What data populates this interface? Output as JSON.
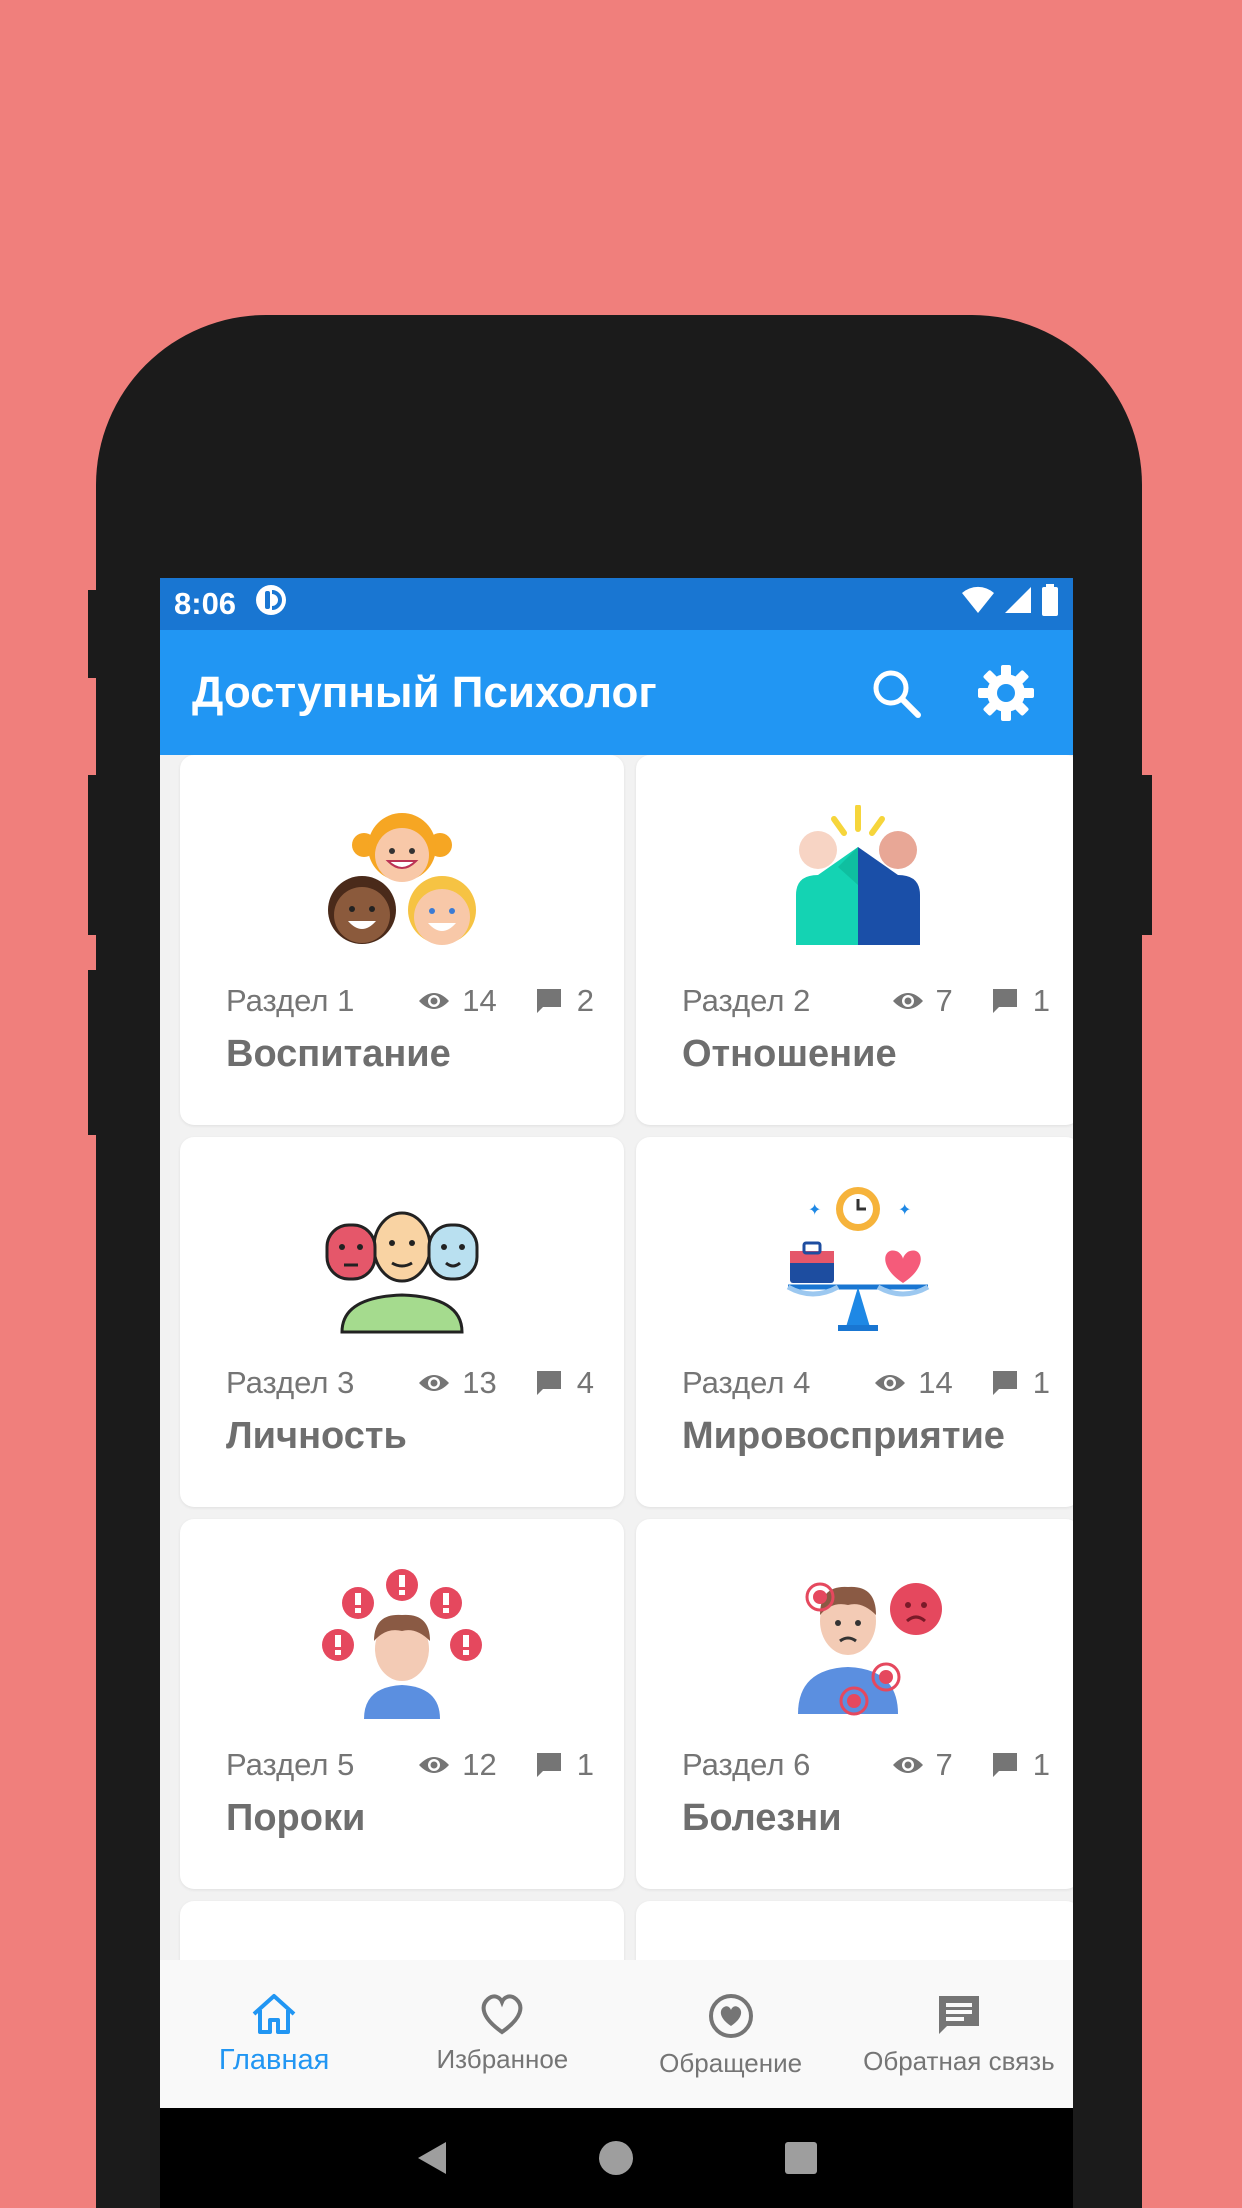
{
  "status_bar": {
    "time": "8:06"
  },
  "app_bar": {
    "title": "Доступный Психолог"
  },
  "cards": [
    {
      "section": "Раздел 1",
      "views": "14",
      "comments": "2",
      "name": "Воспитание",
      "icon": "children-icon"
    },
    {
      "section": "Раздел 2",
      "views": "7",
      "comments": "1",
      "name": "Отношение",
      "icon": "relationship-icon"
    },
    {
      "section": "Раздел 3",
      "views": "13",
      "comments": "4",
      "name": "Личность",
      "icon": "masks-personality-icon"
    },
    {
      "section": "Раздел 4",
      "views": "14",
      "comments": "1",
      "name": "Мировосприятие",
      "icon": "balance-scale-icon"
    },
    {
      "section": "Раздел 5",
      "views": "12",
      "comments": "1",
      "name": "Пороки",
      "icon": "person-alerts-icon"
    },
    {
      "section": "Раздел 6",
      "views": "7",
      "comments": "1",
      "name": "Болезни",
      "icon": "sick-person-icon"
    }
  ],
  "bottom_nav": {
    "items": [
      {
        "label": "Главная",
        "icon": "home-icon",
        "active": true
      },
      {
        "label": "Избранное",
        "icon": "heart-icon",
        "active": false
      },
      {
        "label": "Обращение",
        "icon": "heart-circle-icon",
        "active": false
      },
      {
        "label": "Обратная связь",
        "icon": "message-icon",
        "active": false
      }
    ]
  },
  "colors": {
    "background": "#F07F7C",
    "status_bar": "#1976D2",
    "app_bar": "#2196F3",
    "active_nav": "#2196F3",
    "text_gray": "#757575"
  }
}
